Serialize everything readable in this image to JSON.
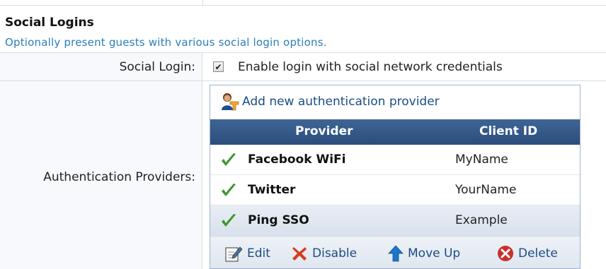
{
  "section": {
    "title": "Social Logins",
    "description": "Optionally present guests with various social login options."
  },
  "social_login": {
    "label": "Social Login:",
    "checked": true,
    "checkbox_label": "Enable login with social network credentials"
  },
  "auth_providers": {
    "label": "Authentication Providers:",
    "add_link": "Add new authentication provider",
    "columns": {
      "provider": "Provider",
      "client_id": "Client ID"
    },
    "rows": [
      {
        "provider": "Facebook WiFi",
        "client_id": "MyName",
        "enabled_icon": "green-check-icon"
      },
      {
        "provider": "Twitter",
        "client_id": "YourName",
        "enabled_icon": "green-check-icon"
      },
      {
        "provider": "Ping SSO",
        "client_id": "Example",
        "enabled_icon": "green-check-icon",
        "selected": true
      }
    ],
    "toolbar": {
      "edit": "Edit",
      "disable": "Disable",
      "move_up": "Move Up",
      "delete": "Delete"
    }
  },
  "colors": {
    "accent_blue": "#2a7fb8",
    "link_blue": "#1c4d86",
    "header_bg": "#2b4d7c",
    "check_green": "#3a9a2a",
    "disable_red": "#d63b1f",
    "delete_red": "#c9302c"
  }
}
